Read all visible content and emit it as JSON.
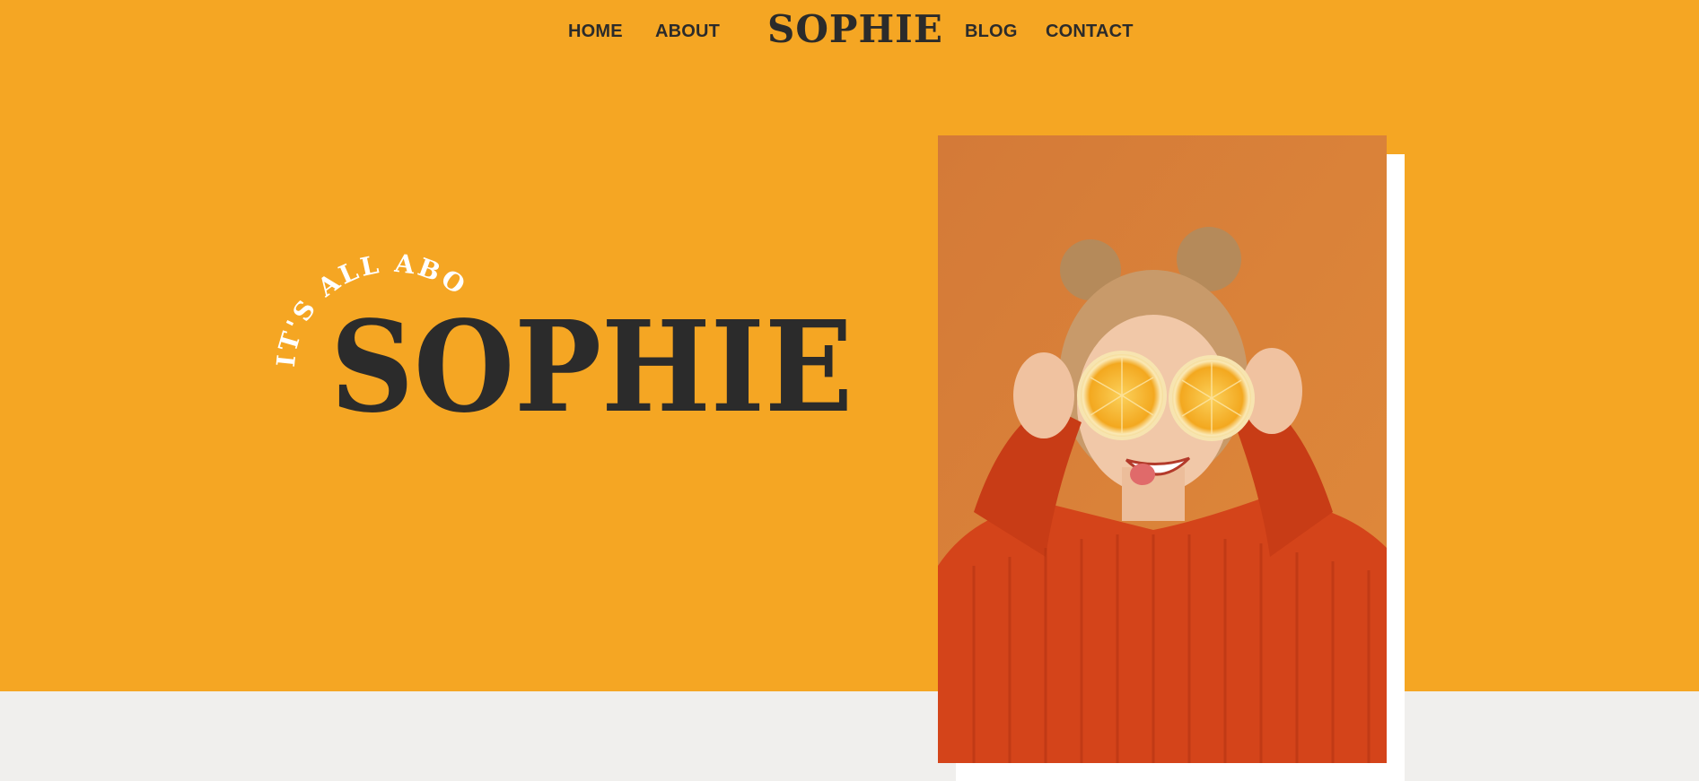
{
  "theme": {
    "hero_bg": "#f5a623",
    "lower_bg": "#f0efed",
    "text_dark": "#2b2b2b",
    "arc_text_color": "#ffffff"
  },
  "nav": {
    "left_links": [
      "HOME",
      "ABOUT"
    ],
    "logo": "SOPHIE",
    "right_links": [
      "BLOG",
      "CONTACT"
    ]
  },
  "hero": {
    "tagline": "IT'S ALL ABOUT",
    "title": "SOPHIE"
  },
  "photo": {
    "alt": "Woman in red sweater holding orange halves over her eyes",
    "bg_color": "#d57a35",
    "sweater_color": "#d4441a",
    "orange_color": "#f5b72e"
  }
}
